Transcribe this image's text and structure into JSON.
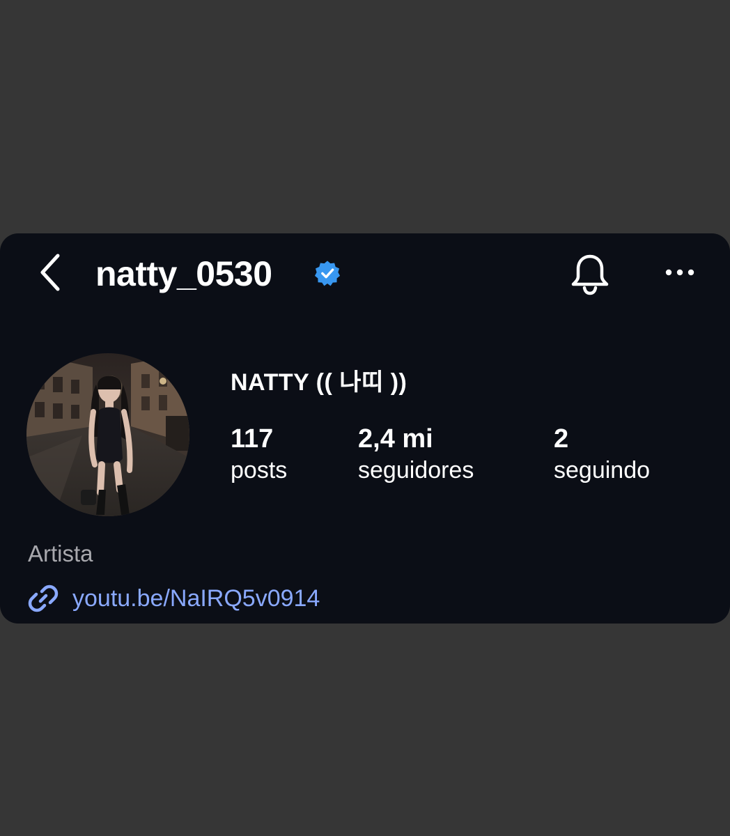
{
  "header": {
    "username": "natty_0530",
    "back_icon": "chevron-left-icon",
    "verified_icon": "verified-badge-icon",
    "bell_icon": "bell-icon",
    "more_icon": "more-horizontal-icon"
  },
  "profile": {
    "display_name": "NATTY (( 나띠 ))",
    "stats": [
      {
        "value": "117",
        "label": "posts"
      },
      {
        "value": "2,4 mi",
        "label": "seguidores"
      },
      {
        "value": "2",
        "label": "seguindo"
      }
    ],
    "category": "Artista",
    "link": "youtu.be/NaIRQ5v0914",
    "link_icon": "link-icon"
  },
  "colors": {
    "page_background": "#363636",
    "card_background": "#0b0e16",
    "verified_blue": "#3897f0",
    "link_blue": "#8aa9ff",
    "category_gray": "#a8a8ad"
  }
}
